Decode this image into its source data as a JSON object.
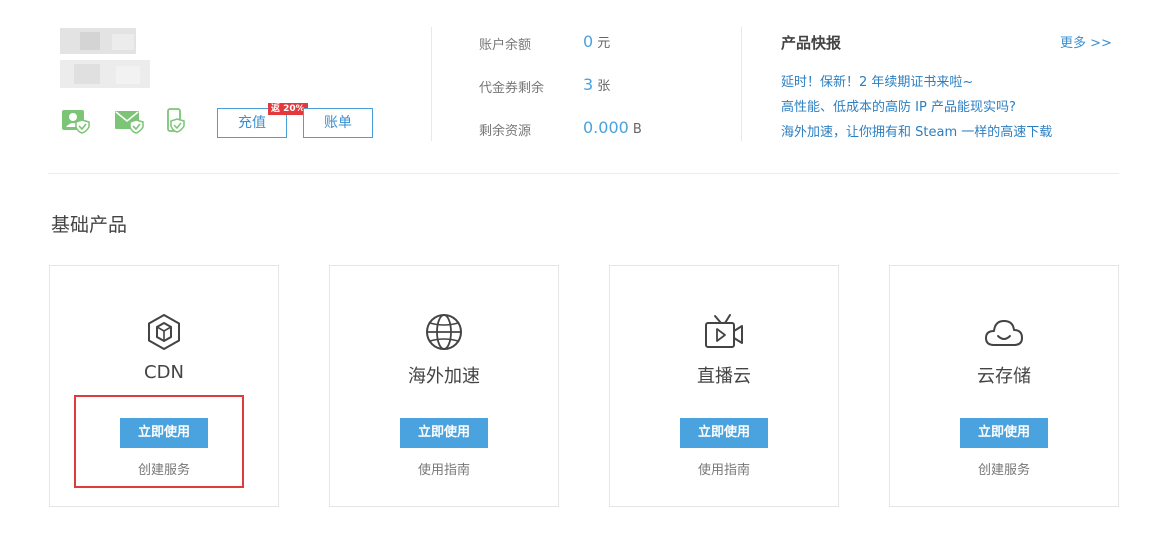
{
  "account": {
    "recharge_label": "充值",
    "bill_label": "账单",
    "promo_badge": "返 20%",
    "icons": [
      "user-verify-icon",
      "mail-verify-icon",
      "phone-verify-icon"
    ]
  },
  "stats": [
    {
      "label": "账户余额",
      "value": "0",
      "unit": "元"
    },
    {
      "label": "代金券剩余",
      "value": "3",
      "unit": "张"
    },
    {
      "label": "剩余资源",
      "value": "0.000",
      "unit": "B"
    }
  ],
  "news": {
    "title": "产品快报",
    "more_label": "更多 >>",
    "items": [
      "延时！保新！2 年续期证书来啦~",
      "高性能、低成本的高防 IP 产品能现实吗?",
      "海外加速，让你拥有和 Steam 一样的高速下载"
    ]
  },
  "section": {
    "title": "基础产品"
  },
  "products": [
    {
      "name": "CDN",
      "button": "立即使用",
      "link": "创建服务",
      "icon": "cdn-hexagon-icon"
    },
    {
      "name": "海外加速",
      "button": "立即使用",
      "link": "使用指南",
      "icon": "globe-icon"
    },
    {
      "name": "直播云",
      "button": "立即使用",
      "link": "使用指南",
      "icon": "live-tv-icon"
    },
    {
      "name": "云存储",
      "button": "立即使用",
      "link": "创建服务",
      "icon": "cloud-icon"
    }
  ],
  "colors": {
    "accent": "#4aa3df",
    "link": "#2c7fc2",
    "verify_green": "#7cc576",
    "badge_red": "#e4393c",
    "highlight_red": "#e03a3a"
  }
}
